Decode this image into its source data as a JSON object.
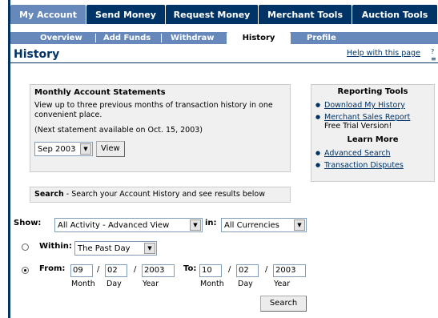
{
  "tabs": [
    "My Account",
    "Send Money",
    "Request Money",
    "Merchant Tools",
    "Auction Tools"
  ],
  "subnav": [
    "Overview",
    "Add Funds",
    "Withdraw",
    "History",
    "Profile"
  ],
  "page_title": "History",
  "help_link": "Help with this page",
  "statements": {
    "heading": "Monthly Account Statements",
    "description": "View up to three previous months of transaction history in one convenient place.",
    "next_statement": "(Next statement available on Oct. 15, 2003)",
    "month_value": "Sep 2003",
    "view_button": "View"
  },
  "search_bar": {
    "bold": "Search",
    "rest": " - Search your Account History and see results below"
  },
  "reporting": {
    "heading": "Reporting Tools",
    "links": [
      "Download My History",
      "Merchant Sales Report"
    ],
    "trial_note": "Free Trial Version!",
    "learn_heading": "Learn More",
    "learn_links": [
      "Advanced Search",
      "Transaction Disputes"
    ]
  },
  "filters": {
    "show_label": "Show:",
    "show_value": "All Activity - Advanced View",
    "in_label": "in:",
    "currency_value": "All Currencies",
    "within_label": "Within:",
    "within_value": "The Past Day",
    "from_label": "From:",
    "from": {
      "month": "09",
      "day": "02",
      "year": "2003"
    },
    "to_label": "To:",
    "to": {
      "month": "10",
      "day": "02",
      "year": "2003"
    },
    "month_cap": "Month",
    "day_cap": "Day",
    "year_cap": "Year",
    "slash": "/",
    "search_button": "Search"
  }
}
